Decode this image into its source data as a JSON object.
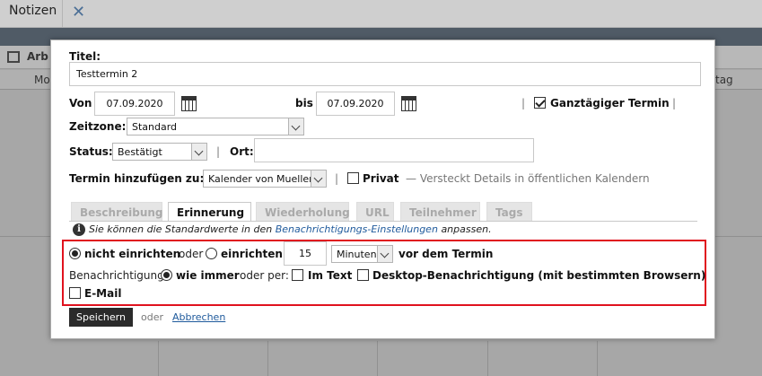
{
  "app": {
    "title": "Notizen",
    "panel_title": "Arb",
    "col_left": "Mo",
    "col_right": "tag"
  },
  "form": {
    "title_label": "Titel:",
    "title_value": "Testtermin 2",
    "from_label": "Von",
    "from_value": "07.09.2020",
    "to_label": "bis",
    "to_value": "07.09.2020",
    "allday_label": "Ganztägiger Termin",
    "allday_checked": true,
    "timezone_label": "Zeitzone:",
    "timezone_value": "Standard",
    "status_label": "Status:",
    "status_value": "Bestätigt",
    "location_label": "Ort:",
    "location_value": "",
    "add_to_label": "Termin hinzufügen zu:",
    "add_to_value": "Kalender von Muellerx",
    "private_label": "Privat",
    "private_hint": "— Versteckt Details in öffentlichen Kalendern",
    "pipe": "|"
  },
  "tabs": [
    {
      "label": "Beschreibung",
      "active": false
    },
    {
      "label": "Erinnerung",
      "active": true
    },
    {
      "label": "Wiederholung",
      "active": false
    },
    {
      "label": "URL",
      "active": false
    },
    {
      "label": "Teilnehmer",
      "active": false
    },
    {
      "label": "Tags",
      "active": false
    }
  ],
  "reminder": {
    "info_prefix": "Sie können die Standardwerte in den",
    "info_link": "Benachrichtigungs-Einstellungen",
    "info_suffix": "anpassen.",
    "opt_none": "nicht einrichten",
    "or_text": "oder",
    "opt_setup": "einrichten",
    "amount": "15",
    "unit": "Minuten",
    "before_text": "vor dem Termin",
    "notify_label": "Benachrichtigung",
    "always_text": "wie immer",
    "or_via_text": "oder per:",
    "in_text": "Im Text",
    "desktop_text": "Desktop-Benachrichtigung (mit bestimmten Browsern)",
    "email_text": "E-Mail"
  },
  "actions": {
    "save_label": "Speichern",
    "or_text": "oder",
    "cancel_label": "Abbrechen"
  },
  "colors": {
    "highlight": "#e0121e",
    "link": "#1f5a9c",
    "save_bg": "#2b2b2b"
  }
}
